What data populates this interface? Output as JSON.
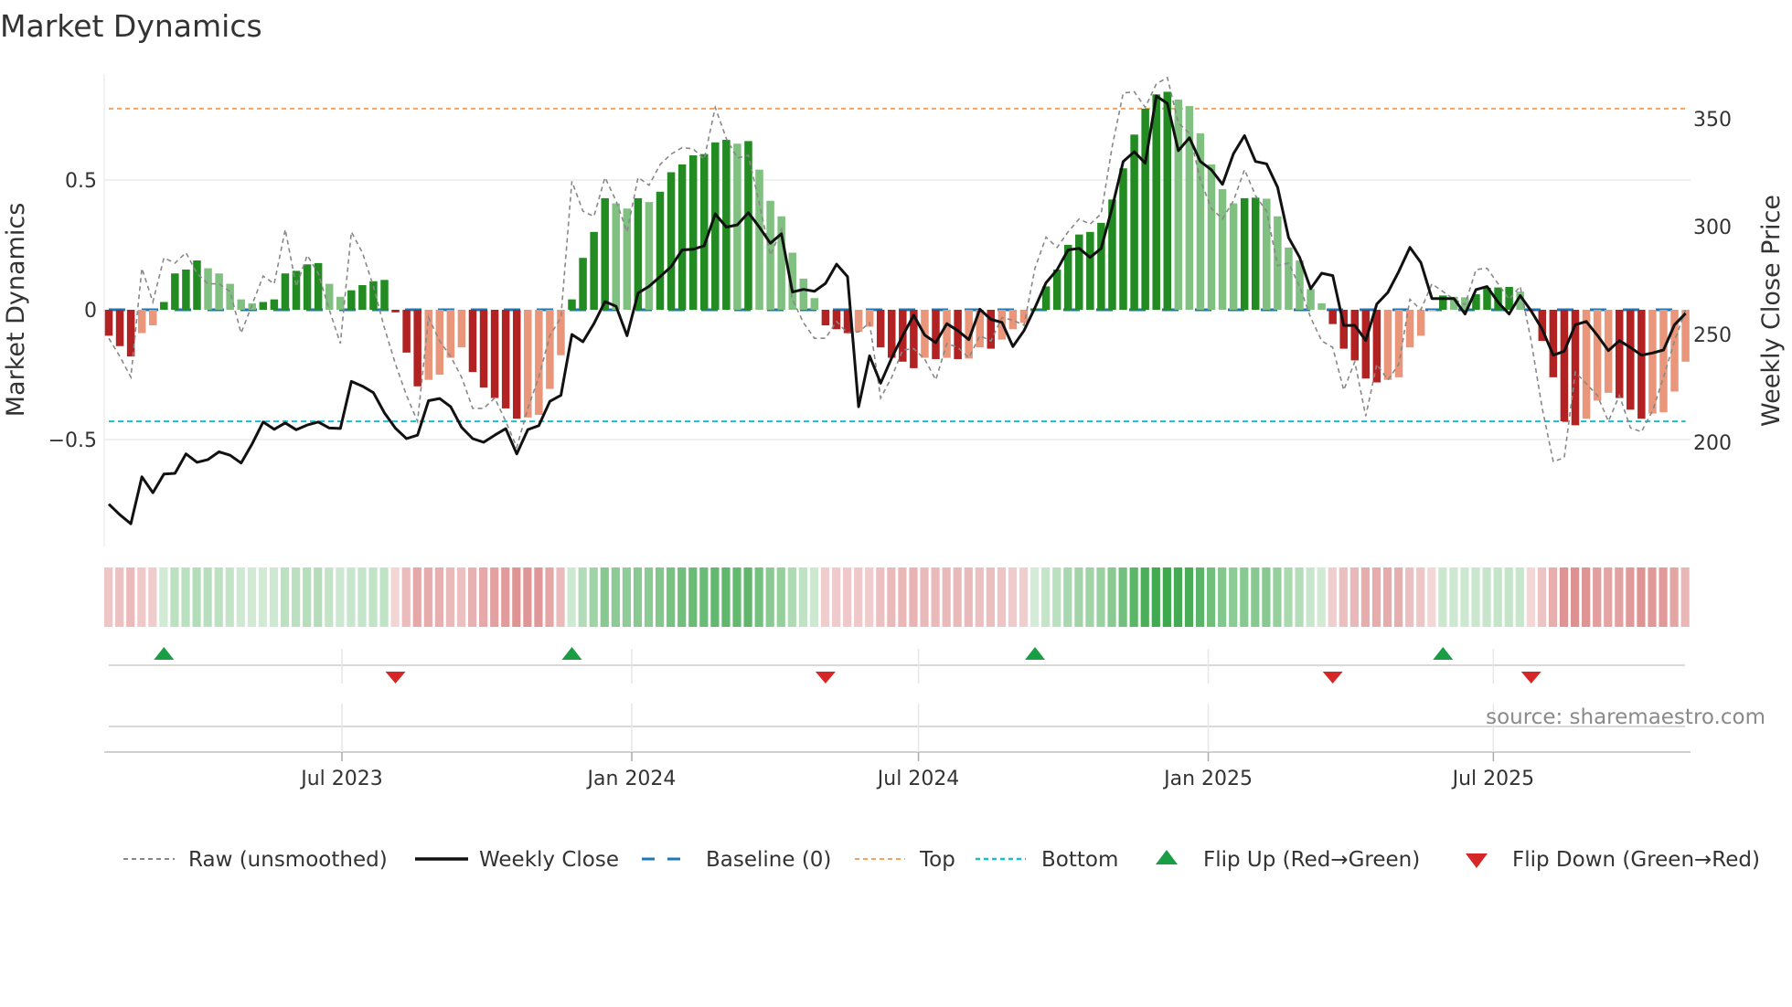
{
  "title": "Market Dynamics",
  "source": "source: sharemaestro.com",
  "colors": {
    "green_dark": "#228b22",
    "green_light": "#80c080",
    "red_dark": "#b22222",
    "red_light": "#e9967a",
    "close": "#111111",
    "raw": "#888888",
    "baseline": "#1f77b4",
    "top": "#f4a460",
    "bottom": "#17becf",
    "flip_up": "#1a9e45",
    "flip_down": "#d62728"
  },
  "legend": [
    {
      "key": "raw",
      "label": "Raw (unsmoothed)"
    },
    {
      "key": "close",
      "label": "Weekly Close"
    },
    {
      "key": "baseline",
      "label": "Baseline (0)"
    },
    {
      "key": "top",
      "label": "Top"
    },
    {
      "key": "bottom",
      "label": "Bottom"
    },
    {
      "key": "flip_up",
      "label": "Flip Up (Red→Green)"
    },
    {
      "key": "flip_down",
      "label": "Flip Down (Green→Red)"
    }
  ],
  "chart_data": {
    "type": "bar",
    "title": "Market Dynamics",
    "ylabel": "Market Dynamics",
    "y2label": "Weekly Close Price",
    "xlabel": "",
    "start_week": "2023-02-03",
    "ylim": [
      -0.9,
      0.92
    ],
    "y2lim": [
      160,
      370
    ],
    "yticks": [
      {
        "v": 0.5,
        "label": "0.5"
      },
      {
        "v": 0,
        "label": "0"
      },
      {
        "v": -0.5,
        "label": "−0.5"
      }
    ],
    "y2ticks": [
      {
        "v": 200,
        "label": "200"
      },
      {
        "v": 250,
        "label": "250"
      },
      {
        "v": 300,
        "label": "300"
      },
      {
        "v": 350,
        "label": "350"
      }
    ],
    "xticks": [
      {
        "date": "2023-07-01",
        "label": "Jul 2023"
      },
      {
        "date": "2024-01-01",
        "label": "Jan 2024"
      },
      {
        "date": "2024-07-01",
        "label": "Jul 2024"
      },
      {
        "date": "2025-01-01",
        "label": "Jan 2025"
      },
      {
        "date": "2025-07-01",
        "label": "Jul 2025"
      }
    ],
    "top_level": 0.775,
    "bottom_level": -0.43,
    "baseline": 0,
    "grid": true,
    "legend_position": "bottom",
    "smoothed": [
      -0.1,
      -0.14,
      -0.18,
      -0.09,
      -0.06,
      0.03,
      0.14,
      0.155,
      0.19,
      0.16,
      0.14,
      0.1,
      0.04,
      0.025,
      0.03,
      0.04,
      0.14,
      0.15,
      0.175,
      0.18,
      0.1,
      0.05,
      0.075,
      0.095,
      0.11,
      0.115,
      -0.01,
      -0.165,
      -0.295,
      -0.27,
      -0.25,
      -0.185,
      -0.145,
      -0.24,
      -0.3,
      -0.34,
      -0.38,
      -0.42,
      -0.415,
      -0.405,
      -0.305,
      -0.175,
      0.04,
      0.2,
      0.3,
      0.43,
      0.41,
      0.39,
      0.43,
      0.415,
      0.455,
      0.53,
      0.56,
      0.595,
      0.6,
      0.645,
      0.655,
      0.64,
      0.65,
      0.54,
      0.42,
      0.36,
      0.22,
      0.12,
      0.045,
      -0.06,
      -0.075,
      -0.09,
      -0.085,
      -0.065,
      -0.145,
      -0.185,
      -0.2,
      -0.225,
      -0.185,
      -0.19,
      -0.185,
      -0.19,
      -0.188,
      -0.145,
      -0.15,
      -0.115,
      -0.075,
      -0.05,
      0.005,
      0.09,
      0.155,
      0.25,
      0.29,
      0.3,
      0.335,
      0.425,
      0.545,
      0.675,
      0.775,
      0.83,
      0.84,
      0.81,
      0.785,
      0.68,
      0.56,
      0.465,
      0.41,
      0.43,
      0.432,
      0.428,
      0.36,
      0.24,
      0.19,
      0.08,
      0.025,
      -0.055,
      -0.15,
      -0.195,
      -0.265,
      -0.28,
      -0.27,
      -0.26,
      -0.145,
      -0.1,
      -0.003,
      0.055,
      0.05,
      0.048,
      0.06,
      0.085,
      0.086,
      0.088,
      0.07,
      -0.005,
      -0.12,
      -0.26,
      -0.43,
      -0.445,
      -0.42,
      -0.35,
      -0.32,
      -0.34,
      -0.385,
      -0.42,
      -0.4,
      -0.395,
      -0.315,
      -0.2
    ],
    "raw": [
      -0.11,
      -0.18,
      -0.26,
      0.16,
      0.03,
      0.2,
      0.18,
      0.22,
      0.14,
      0.1,
      0.1,
      0.07,
      -0.09,
      0.02,
      0.13,
      0.1,
      0.31,
      0.09,
      0.21,
      0.14,
      0,
      -0.13,
      0.3,
      0.22,
      0.09,
      -0.07,
      -0.21,
      -0.33,
      -0.43,
      -0.03,
      -0.12,
      -0.18,
      -0.26,
      -0.38,
      -0.38,
      -0.34,
      -0.43,
      -0.53,
      -0.38,
      -0.26,
      -0.1,
      -0.03,
      0.495,
      0.38,
      0.36,
      0.51,
      0.42,
      0.3,
      0.51,
      0.48,
      0.56,
      0.6,
      0.625,
      0.62,
      0.58,
      0.78,
      0.66,
      0.585,
      0.595,
      0.41,
      0.21,
      0.31,
      0.04,
      -0.05,
      -0.11,
      -0.11,
      -0.045,
      -0.09,
      -0.085,
      -0.05,
      -0.34,
      -0.26,
      -0.155,
      -0.15,
      -0.19,
      -0.27,
      -0.13,
      -0.145,
      -0.185,
      -0.1,
      -0.12,
      -0.03,
      -0.04,
      -0.06,
      0.16,
      0.28,
      0.24,
      0.3,
      0.35,
      0.33,
      0.37,
      0.63,
      0.835,
      0.84,
      0.78,
      0.87,
      0.895,
      0.72,
      0.68,
      0.5,
      0.39,
      0.35,
      0.42,
      0.54,
      0.44,
      0.38,
      0.17,
      0.18,
      0.09,
      -0.03,
      -0.12,
      -0.145,
      -0.31,
      -0.2,
      -0.41,
      -0.21,
      -0.27,
      -0.21,
      0.04,
      0,
      0.1,
      0.07,
      0.04,
      0.02,
      0.155,
      0.16,
      0.1,
      0.04,
      0.09,
      -0.12,
      -0.38,
      -0.585,
      -0.57,
      -0.24,
      -0.285,
      -0.33,
      -0.43,
      -0.33,
      -0.455,
      -0.47,
      -0.39,
      -0.26,
      -0.12,
      0
    ],
    "close": [
      171.3,
      166.4,
      162.2,
      184.0,
      176.6,
      185.3,
      185.6,
      194.6,
      190.7,
      192.0,
      195.6,
      194.0,
      190.4,
      199.3,
      209.4,
      206.0,
      209.0,
      205.8,
      208.0,
      209.4,
      206.6,
      206.4,
      228.2,
      226.0,
      223.0,
      213.6,
      206.5,
      201.7,
      203.3,
      219.3,
      220.3,
      216.5,
      206.9,
      201.7,
      200.0,
      203.3,
      206.3,
      194.6,
      205.9,
      207.7,
      219.0,
      221.8,
      250.0,
      246.6,
      255.0,
      265.2,
      263.1,
      249.4,
      269.2,
      272.3,
      276.8,
      281.5,
      289.2,
      289.5,
      291.1,
      305.9,
      299.8,
      300.8,
      306.5,
      299.8,
      292.3,
      296.7,
      269.7,
      270.9,
      270.0,
      273.7,
      282.6,
      276.8,
      216.5,
      240.1,
      227.4,
      239.1,
      249.4,
      258.9,
      249.7,
      246.2,
      255.0,
      251.8,
      247.6,
      261.7,
      257.0,
      255.6,
      244.4,
      251.8,
      262.4,
      274.0,
      280.0,
      289.2,
      289.9,
      285.7,
      289.9,
      309.0,
      330.2,
      334.7,
      329.4,
      360.6,
      357.1,
      335.2,
      341.2,
      330.2,
      326.3,
      319.6,
      333.8,
      342.2,
      330.2,
      329.1,
      318.2,
      294.9,
      285.7,
      271.2,
      278.4,
      277.3,
      254.2,
      254.2,
      247.2,
      264.1,
      269.5,
      279.3,
      290.4,
      283.3,
      266.6,
      266.6,
      266.6,
      259.5,
      270.8,
      272.2,
      264.9,
      259.5,
      268.0,
      260.9,
      252.4,
      240.4,
      242.2,
      254.5,
      256.0,
      249.6,
      242.5,
      247.1,
      244.0,
      240.4,
      241.4,
      242.8,
      254.5,
      259.8
    ],
    "flip_up_weeks": [
      5,
      42,
      84,
      121
    ],
    "flip_down_weeks": [
      26,
      65,
      111,
      129
    ]
  }
}
